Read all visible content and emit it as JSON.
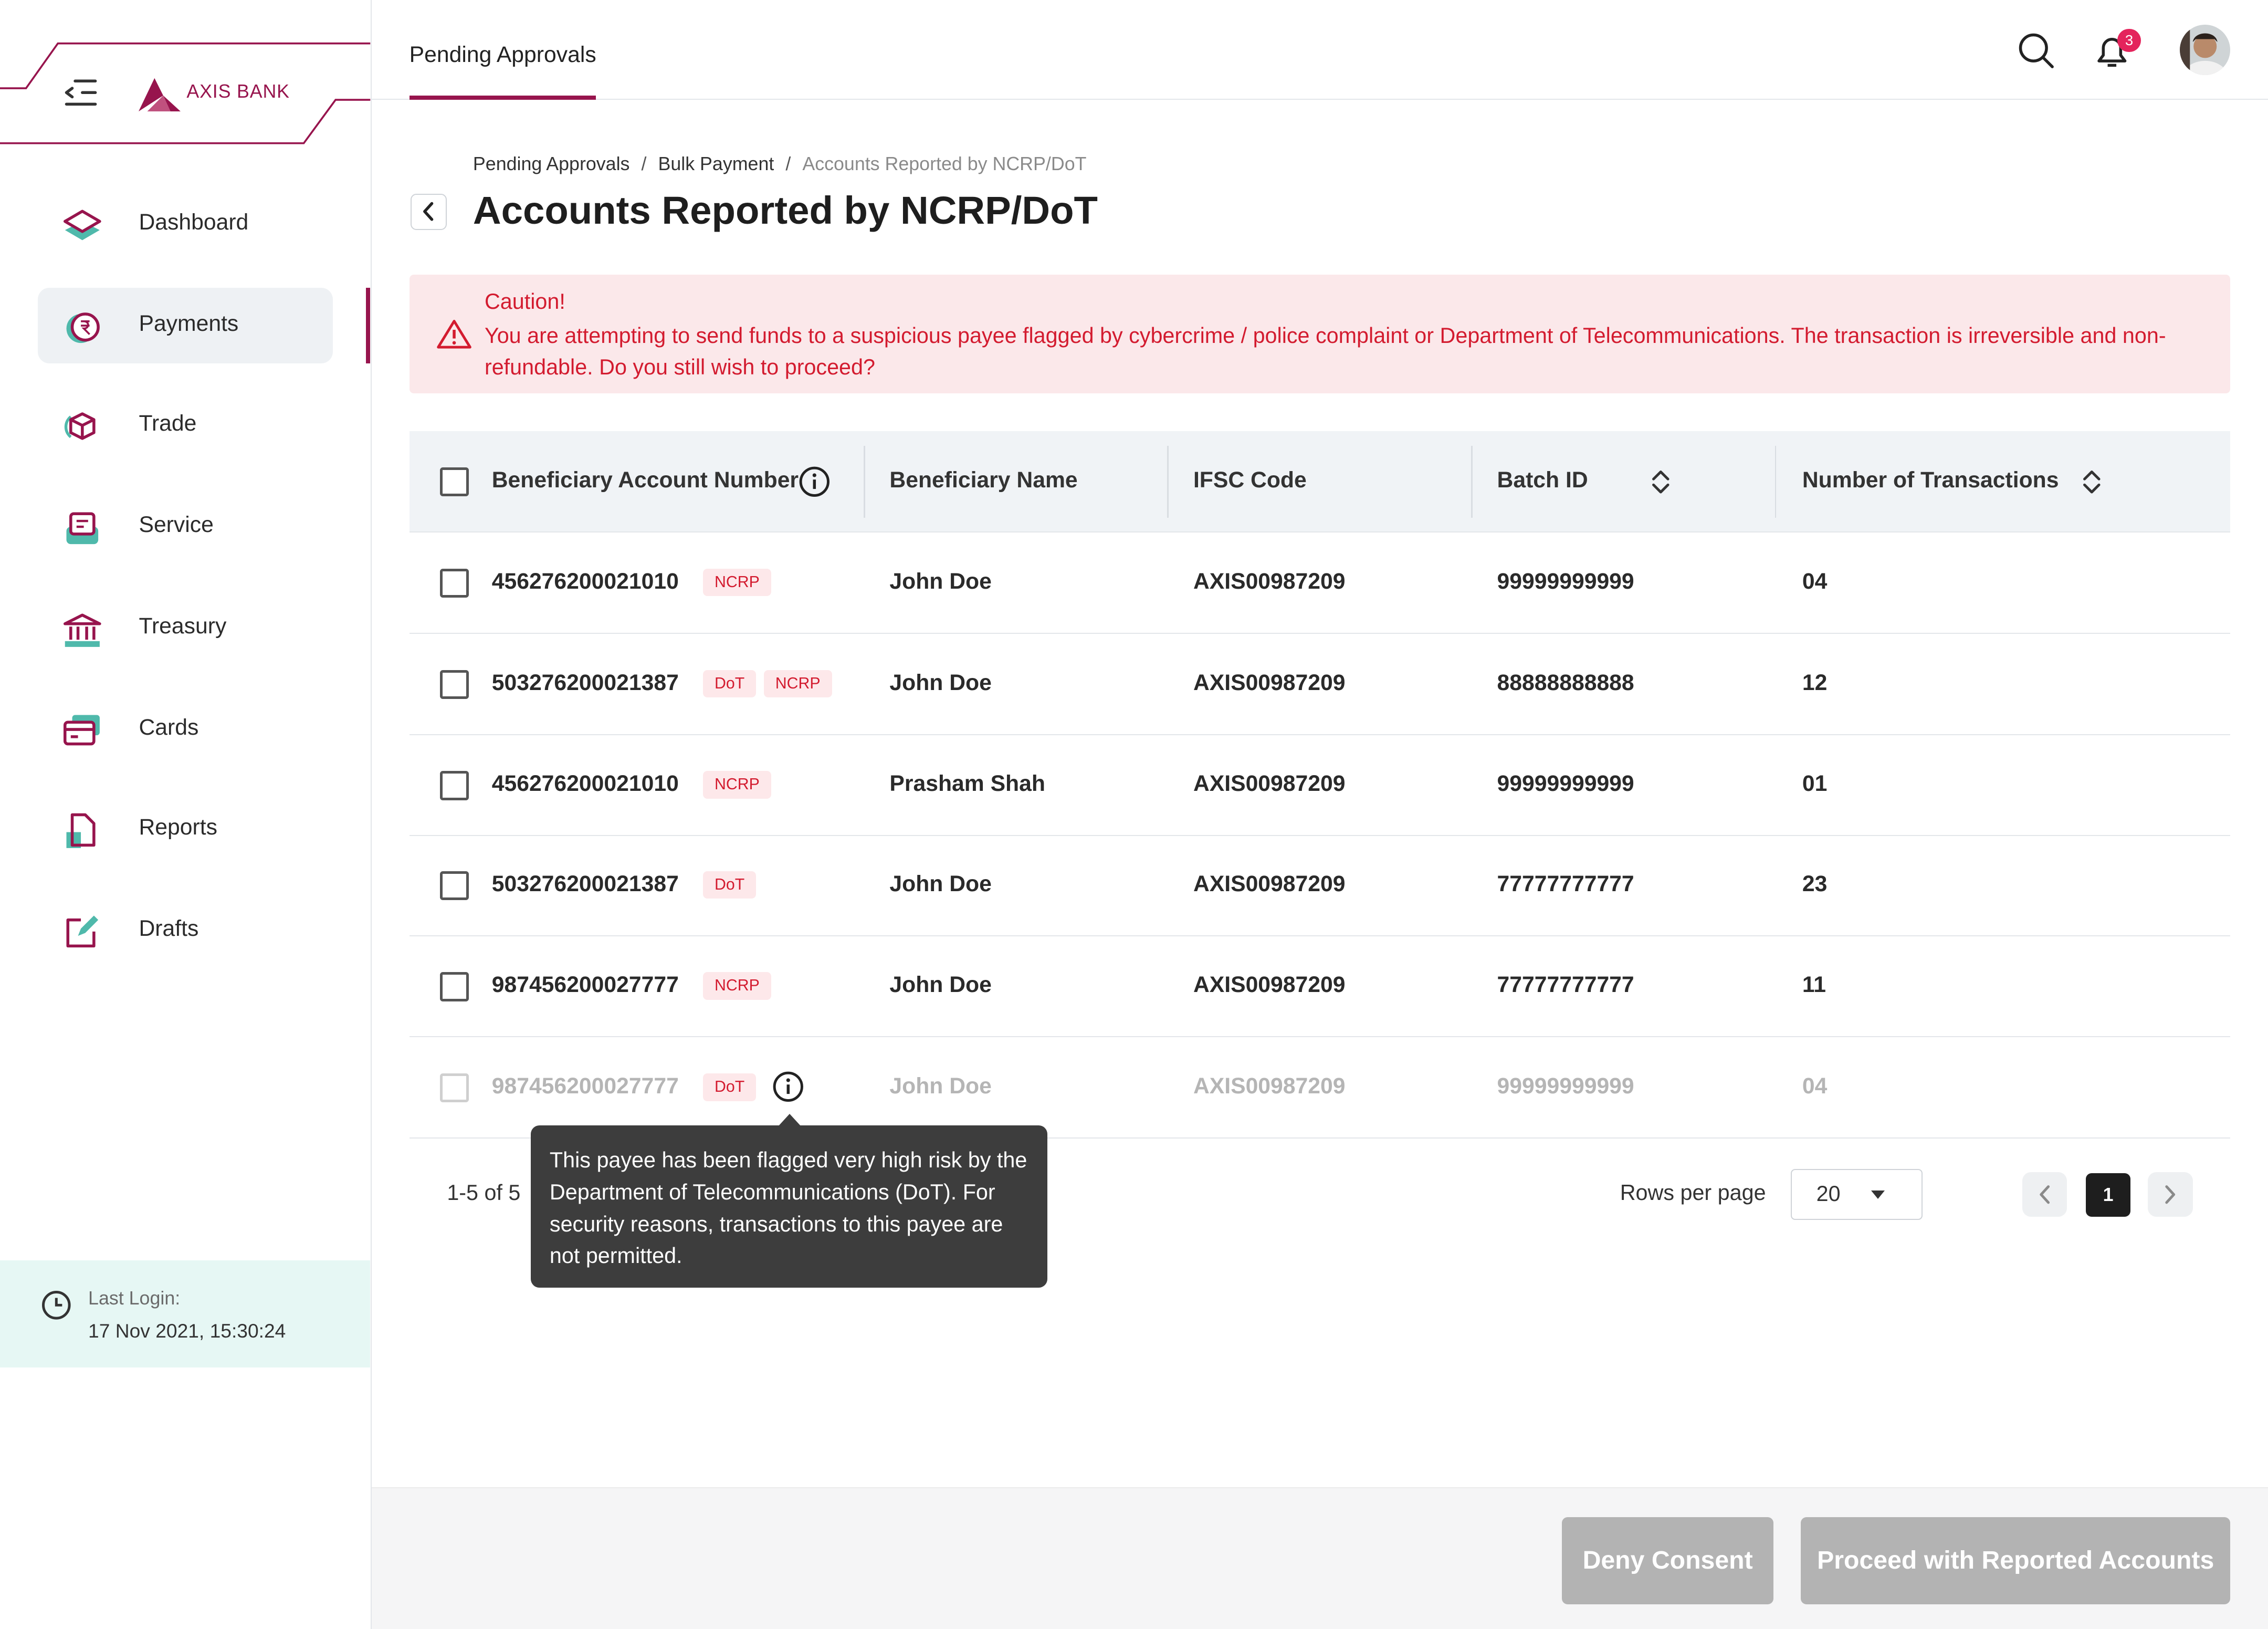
{
  "brand": {
    "name": "AXIS BANK",
    "accent": "#97144d",
    "teal": "#4fb9ab",
    "alert_red": "#d31b2f"
  },
  "sidebar": {
    "items": [
      {
        "label": "Dashboard",
        "icon": "layers-icon"
      },
      {
        "label": "Payments",
        "icon": "rupee-coin-icon",
        "active": true
      },
      {
        "label": "Trade",
        "icon": "cube-icon"
      },
      {
        "label": "Service",
        "icon": "service-inbox-icon"
      },
      {
        "label": "Treasury",
        "icon": "bank-building-icon"
      },
      {
        "label": "Cards",
        "icon": "credit-card-icon"
      },
      {
        "label": "Reports",
        "icon": "report-file-icon"
      },
      {
        "label": "Drafts",
        "icon": "edit-draft-icon"
      }
    ],
    "last_login_label": "Last Login:",
    "last_login_value": "17 Nov 2021, 15:30:24"
  },
  "header": {
    "tab": "Pending Approvals",
    "notification_count": "3"
  },
  "breadcrumb": [
    "Pending Approvals",
    "Bulk Payment",
    "Accounts Reported by NCRP/DoT"
  ],
  "title": "Accounts Reported by NCRP/DoT",
  "caution": {
    "title": "Caution!",
    "body": "You are attempting to send funds to a suspicious payee flagged by cybercrime / police complaint or Department of Telecommunications. The transaction is irreversible and non-refundable. Do you still wish to proceed?"
  },
  "table": {
    "columns": [
      "Beneficiary Account Number",
      "Beneficiary Name",
      "IFSC Code",
      "Batch ID",
      "Number of Transactions"
    ],
    "rows": [
      {
        "account": "456276200021010",
        "tags": [
          "NCRP"
        ],
        "name": "John Doe",
        "ifsc": "AXIS00987209",
        "batch": "99999999999",
        "txns": "04"
      },
      {
        "account": "503276200021387",
        "tags": [
          "DoT",
          "NCRP"
        ],
        "name": "John Doe",
        "ifsc": "AXIS00987209",
        "batch": "88888888888",
        "txns": "12"
      },
      {
        "account": "456276200021010",
        "tags": [
          "NCRP"
        ],
        "name": "Prasham Shah",
        "ifsc": "AXIS00987209",
        "batch": "99999999999",
        "txns": "01"
      },
      {
        "account": "503276200021387",
        "tags": [
          "DoT"
        ],
        "name": "John Doe",
        "ifsc": "AXIS00987209",
        "batch": "77777777777",
        "txns": "23"
      },
      {
        "account": "987456200027777",
        "tags": [
          "NCRP"
        ],
        "name": "John Doe",
        "ifsc": "AXIS00987209",
        "batch": "77777777777",
        "txns": "11"
      },
      {
        "account": "987456200027777",
        "tags": [
          "DoT"
        ],
        "name": "John Doe",
        "ifsc": "AXIS00987209",
        "batch": "99999999999",
        "txns": "04",
        "disabled": true
      }
    ]
  },
  "tooltip": "This payee has been flagged very high risk by the Department of Telecommunications (DoT). For security reasons, transactions to this payee are not permitted.",
  "pagination": {
    "range": "1-5 of 5",
    "rows_per_page_label": "Rows per page",
    "rows_per_page": "20",
    "page": "1"
  },
  "footer": {
    "deny": "Deny Consent",
    "proceed": "Proceed with Reported Accounts"
  }
}
